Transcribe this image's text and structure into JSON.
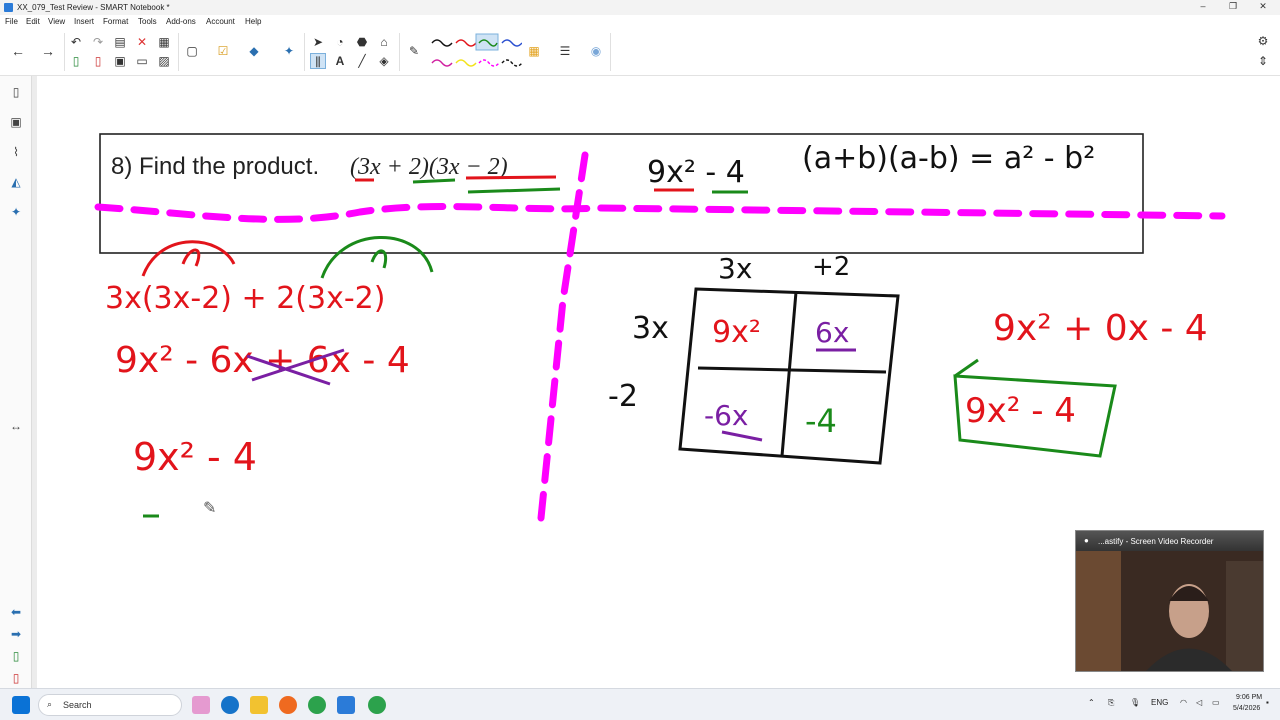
{
  "window": {
    "title": "XX_079_Test Review - SMART Notebook *",
    "controls": [
      "–",
      "❐",
      "✕"
    ]
  },
  "menu": [
    "File",
    "Edit",
    "View",
    "Insert",
    "Format",
    "Tools",
    "Add-ons",
    "Account",
    "Help"
  ],
  "problem": {
    "number_label": "8) Find the product.",
    "expr_open": "(3x + 2)(3x − 2)"
  },
  "handwriting": {
    "formula": "(a+b)(a-b) = a² - b²",
    "result_top": "9x² - 4",
    "expand_line1": "3x(3x-2) + 2(3x-2)",
    "expand_line2": "9x² - 6x + 6x - 4",
    "expand_line3": "9x² - 4",
    "box_top_labels": [
      "3x",
      "+2"
    ],
    "box_side_labels": [
      "3x",
      "-2"
    ],
    "box_cells": [
      "9x²",
      "6x",
      "-6x",
      "-4"
    ],
    "right_expr": "9x² + 0x - 4",
    "boxed_answer": "9x² - 4"
  },
  "webcam": {
    "title": "...astify - Screen Video Recorder"
  },
  "taskbar": {
    "search_placeholder": "Search",
    "lang": "ENG",
    "time": "9:06 PM",
    "date": "5/4/2026"
  },
  "colors": {
    "red": "#e2141b",
    "green": "#1a8a1a",
    "purple": "#7a1fa3",
    "magenta": "#ff00ff",
    "black": "#111111"
  }
}
